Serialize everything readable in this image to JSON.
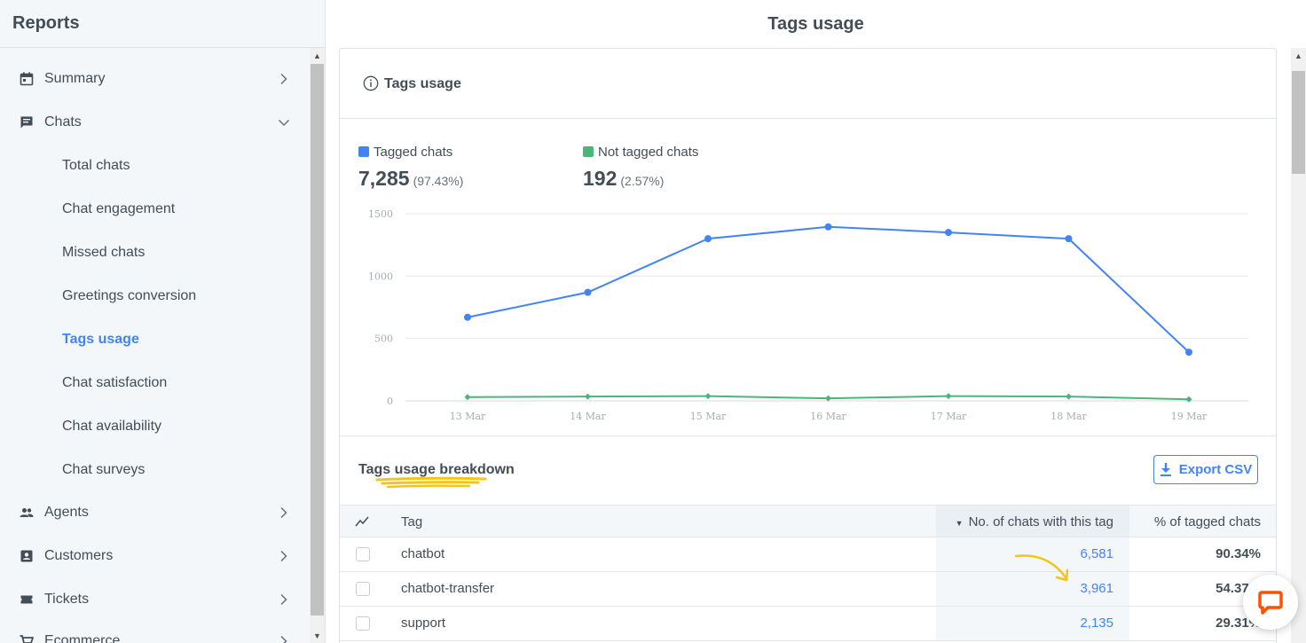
{
  "sidebar": {
    "title": "Reports",
    "items": [
      {
        "label": "Summary",
        "icon": "calendar-icon"
      },
      {
        "label": "Chats",
        "icon": "chat-icon"
      },
      {
        "label": "Agents",
        "icon": "people-icon"
      },
      {
        "label": "Customers",
        "icon": "contact-card-icon"
      },
      {
        "label": "Tickets",
        "icon": "ticket-icon"
      },
      {
        "label": "Ecommerce",
        "icon": "cart-icon"
      }
    ],
    "chat_subitems": [
      "Total chats",
      "Chat engagement",
      "Missed chats",
      "Greetings conversion",
      "Tags usage",
      "Chat satisfaction",
      "Chat availability",
      "Chat surveys"
    ],
    "active_subitem": "Tags usage"
  },
  "header": {
    "title": "Tags usage"
  },
  "card": {
    "title": "Tags usage"
  },
  "summary": {
    "tagged": {
      "label": "Tagged chats",
      "value": "7,285",
      "percent": "(97.43%)",
      "color": "#4384f5"
    },
    "not_tagged": {
      "label": "Not tagged chats",
      "value": "192",
      "percent": "(2.57%)",
      "color": "#4bb678"
    }
  },
  "chart_data": {
    "type": "line",
    "x": [
      "13 Mar",
      "14 Mar",
      "15 Mar",
      "16 Mar",
      "17 Mar",
      "18 Mar",
      "19 Mar"
    ],
    "y_ticks": [
      0,
      500,
      1000,
      1500
    ],
    "ylim": [
      0,
      1500
    ],
    "grid": true,
    "series": [
      {
        "name": "Tagged chats",
        "color": "#4384f5",
        "values": [
          670,
          870,
          1300,
          1395,
          1350,
          1300,
          390
        ]
      },
      {
        "name": "Not tagged chats",
        "color": "#4bb678",
        "values": [
          30,
          35,
          38,
          20,
          38,
          35,
          12
        ]
      }
    ]
  },
  "breakdown": {
    "title": "Tags usage breakdown",
    "export_label": "Export CSV",
    "columns": {
      "tag": "Tag",
      "count": "No. of chats with this tag",
      "percent": "% of tagged chats"
    },
    "rows": [
      {
        "tag": "chatbot",
        "count": "6,581",
        "percent": "90.34%"
      },
      {
        "tag": "chatbot-transfer",
        "count": "3,961",
        "percent": "54.37%"
      },
      {
        "tag": "support",
        "count": "2,135",
        "percent": "29.31%"
      }
    ]
  }
}
